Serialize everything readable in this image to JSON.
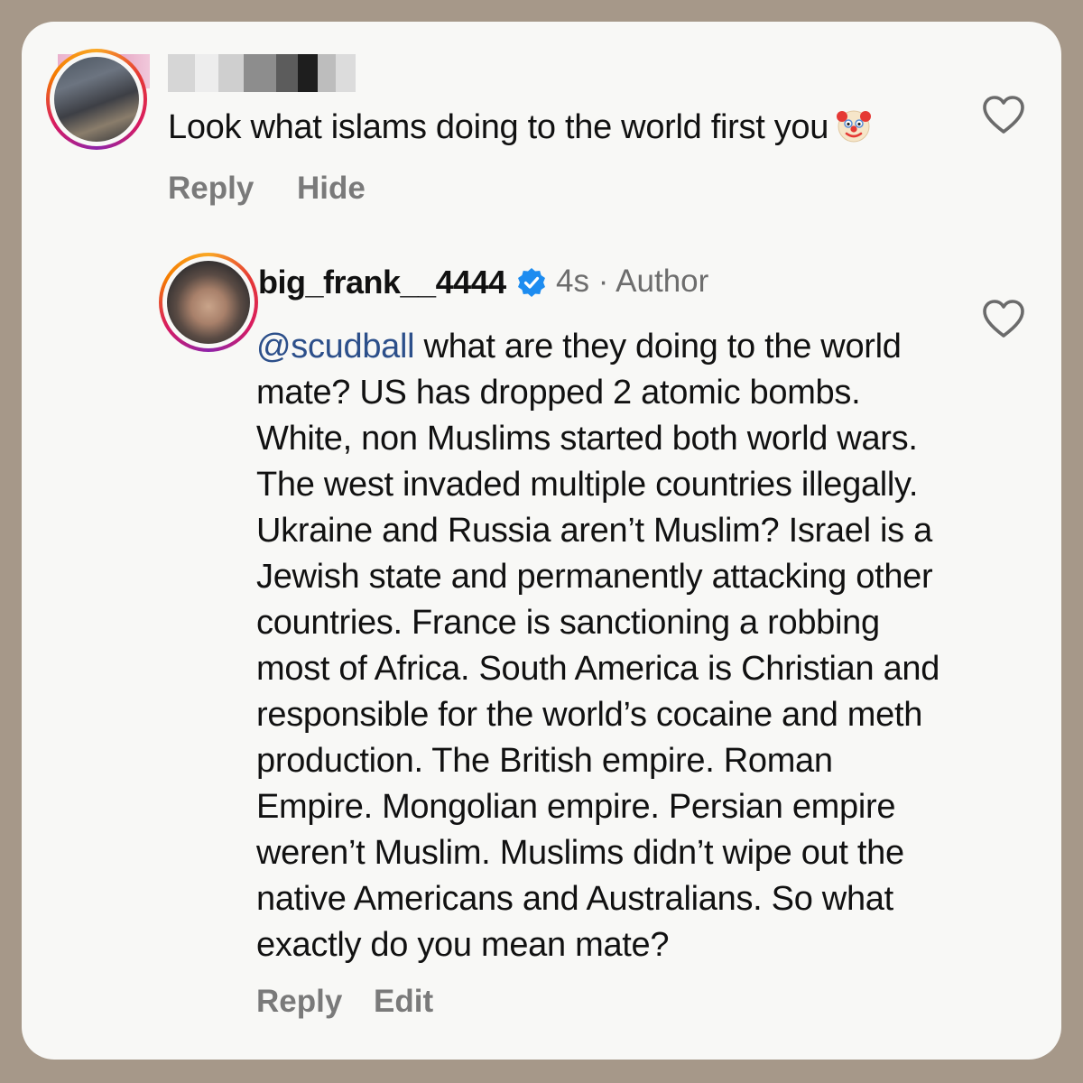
{
  "comment": {
    "text": "Look what islams doing to the world first you",
    "emoji_icon": "clown-face-icon",
    "actions": {
      "reply": "Reply",
      "hide": "Hide"
    },
    "like_icon": "heart-outline-icon"
  },
  "reply": {
    "username": "big_frank__4444",
    "verified_icon": "verified-badge-icon",
    "time": "4s",
    "separator": "·",
    "role": "Author",
    "mention": "@scudball",
    "lines": [
      " what are they doing to the world",
      "mate? US has dropped 2 atomic bombs.",
      "White, non Muslims started both world wars.",
      "The west invaded multiple countries illegally.",
      "Ukraine and Russia aren’t Muslim? Israel is a",
      "Jewish state and permanently attacking other",
      "countries. France is sanctioning a robbing",
      "most of Africa. South America is Christian and",
      "responsible for the world’s cocaine and meth",
      "production. The British empire. Roman",
      "Empire. Mongolian empire. Persian empire",
      "weren’t Muslim. Muslims didn’t wipe out the",
      "native Americans and Australians. So what",
      "exactly do you mean mate?"
    ],
    "actions": {
      "reply": "Reply",
      "edit": "Edit"
    },
    "like_icon": "heart-outline-icon"
  },
  "colors": {
    "background": "#a69889",
    "card": "#f8f8f6",
    "mention": "#2c4f8a",
    "verified": "#1d8cf0",
    "muted": "#7a7a7a"
  }
}
